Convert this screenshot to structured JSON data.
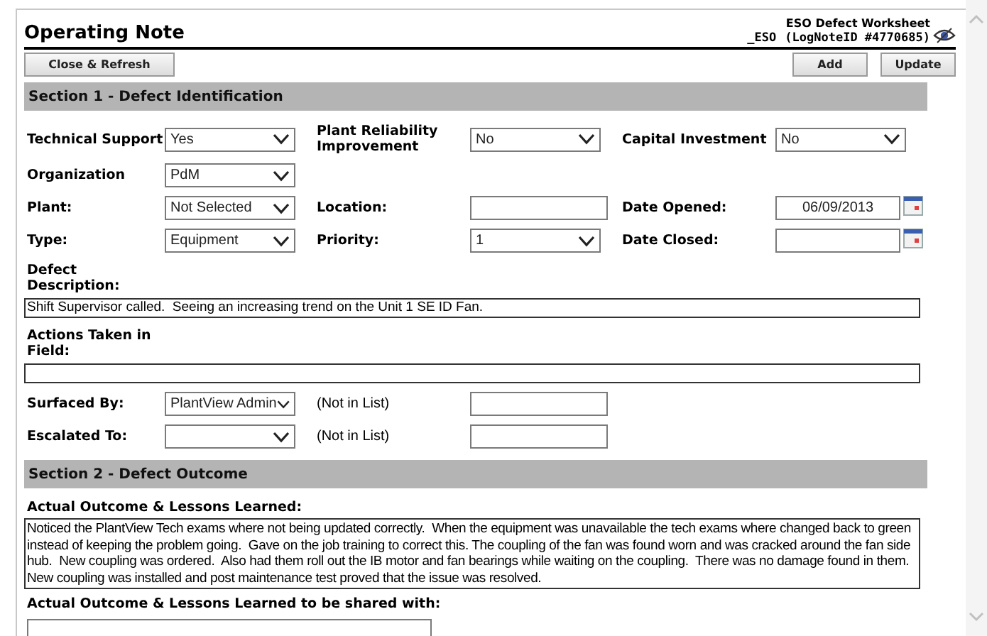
{
  "header": {
    "title": "Operating Note",
    "worksheet": "ESO Defect Worksheet",
    "prefix": "_ESO",
    "log_id": "(LogNoteID #4770685)"
  },
  "buttons_left": [
    "Close & Refresh"
  ],
  "buttons_right": [
    "Add",
    "Update"
  ],
  "section1": {
    "title": "Section 1 - Defect Identification",
    "rows": [
      [
        {
          "label": "Technical Support",
          "kind": "select",
          "value": "Yes"
        },
        {
          "label": "Plant Reliability Improvement",
          "kind": "select",
          "value": "No"
        },
        {
          "label": "Capital Investment",
          "kind": "select",
          "value": "No"
        }
      ],
      [
        {
          "label": "Organization",
          "kind": "select",
          "value": "PdM"
        }
      ],
      [
        {
          "label": "Plant:",
          "kind": "select",
          "value": "Not Selected"
        },
        {
          "label": "Location:",
          "kind": "text"
        },
        {
          "label": "Date Opened:",
          "kind": "date",
          "value": "06/09/2013"
        }
      ],
      [
        {
          "label": "Type:",
          "kind": "select",
          "value": "Equipment"
        },
        {
          "label": "Priority:",
          "kind": "select",
          "value": "1"
        },
        {
          "label": "Date Closed:",
          "kind": "date"
        }
      ]
    ],
    "wide_fields": [
      {
        "label": "Defect Description:",
        "value": "Shift Supervisor called.  Seeing an increasing trend on the Unit 1 SE ID Fan."
      },
      {
        "label": "Actions Taken in Field:"
      }
    ],
    "rows2": [
      [
        {
          "label": "Surfaced By:",
          "kind": "select",
          "value": "PlantView Admin"
        },
        {
          "label": "(Not in List)",
          "kind": "text",
          "plain_label": true
        }
      ],
      [
        {
          "label": "Escalated To:",
          "kind": "select"
        },
        {
          "label": "(Not in List)",
          "kind": "text",
          "plain_label": true
        }
      ]
    ]
  },
  "section2": {
    "title": "Section 2 - Defect Outcome",
    "outcome": {
      "label": "Actual Outcome & Lessons Learned:",
      "value": "Noticed the PlantView Tech exams where not being updated correctly.  When the equipment was unavailable the tech exams where changed back to green instead of keeping the problem going.  Gave on the job training to correct this. The coupling of the fan was found worn and was cracked around the fan side hub.  New coupling was ordered.  Also had them roll out the IB motor and fan bearings while waiting on the coupling.  There was no damage found in them.  New coupling was installed and post maintenance test proved that the issue was resolved."
    },
    "shared": {
      "label": "Actual Outcome & Lessons Learned to be shared with:"
    }
  }
}
